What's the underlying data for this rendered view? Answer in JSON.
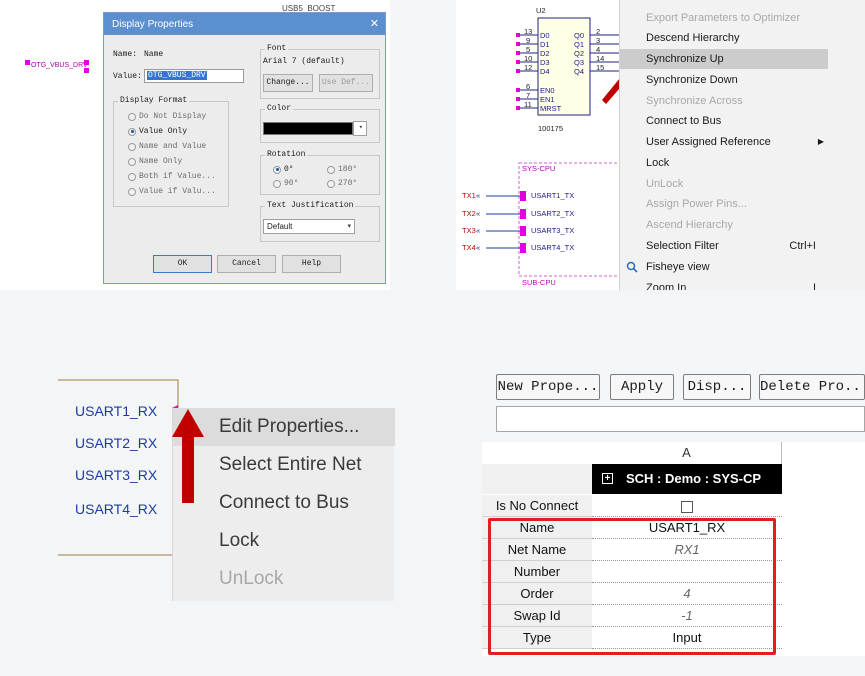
{
  "colors": {
    "accent_red": "#c00000",
    "highlight_box": "#e02020",
    "net_magenta": "#e000e0",
    "net_blue": "#1e3ca0",
    "dialog_title_bg": "#5b8fd0",
    "component_header_bg": "#000000"
  },
  "panel_display_properties": {
    "pin_label": "OTG_VBUS_DRV",
    "top_partial_text": "USB5_BOOST",
    "dialog": {
      "title": "Display Properties",
      "close_icon": "close-icon",
      "name_label": "Name:",
      "name_value": "Name",
      "value_label": "Value:",
      "value_field": "OTG_VBUS_DRV",
      "display_format": {
        "title": "Display Format",
        "options": [
          "Do Not Display",
          "Value Only",
          "Name and Value",
          "Name Only",
          "Both if Value...",
          "Value if Valu..."
        ],
        "selected_index": 1
      },
      "font": {
        "title": "Font",
        "value": "Arial 7 (default)",
        "change_button": "Change...",
        "use_default_button": "Use Def..."
      },
      "color": {
        "title": "Color",
        "swatch": "#000000"
      },
      "rotation": {
        "title": "Rotation",
        "options": [
          "0°",
          "180°",
          "90°",
          "270°"
        ],
        "selected_index": 0
      },
      "justification": {
        "title": "Text Justification",
        "value": "Default"
      },
      "ok_button": "OK",
      "cancel_button": "Cancel",
      "help_button": "Help"
    }
  },
  "panel_context_menu": {
    "schematic": {
      "ref": "U2",
      "part_number": "100175",
      "left_pins": [
        "D0",
        "D1",
        "D2",
        "D3",
        "D4",
        "EN0",
        "EN1",
        "MRST"
      ],
      "left_pin_numbers": [
        "13",
        "9",
        "5",
        "10",
        "12",
        "6",
        "7",
        "11"
      ],
      "right_pins": [
        "Q0",
        "Q1",
        "Q2",
        "Q3",
        "Q4"
      ],
      "right_pin_numbers": [
        "2",
        "3",
        "4",
        "14",
        "15"
      ],
      "sys_block_label": "SYS-CPU",
      "sub_block_label": "SUB-CPU",
      "ports": [
        "USART1_TX",
        "USART2_TX",
        "USART3_TX",
        "USART4_TX"
      ],
      "nets": [
        "TX1",
        "TX2",
        "TX3",
        "TX4"
      ]
    },
    "menu_items": [
      {
        "label": "Export Parameters to Optimizer",
        "disabled": true
      },
      {
        "label": "Descend Hierarchy",
        "disabled": false
      },
      {
        "label": "Synchronize Up",
        "disabled": false,
        "highlighted": true
      },
      {
        "label": "Synchronize Down",
        "disabled": false
      },
      {
        "label": "Synchronize Across",
        "disabled": true
      },
      {
        "label": "Connect to Bus",
        "disabled": false
      },
      {
        "label": "User Assigned Reference",
        "disabled": false,
        "submenu": true
      },
      {
        "label": "Lock",
        "disabled": false
      },
      {
        "label": "UnLock",
        "disabled": true
      },
      {
        "label": "Assign Power Pins...",
        "disabled": true
      },
      {
        "label": "Ascend Hierarchy",
        "disabled": true
      },
      {
        "label": "Selection Filter",
        "disabled": false,
        "shortcut": "Ctrl+I"
      },
      {
        "label": "Fisheye view",
        "disabled": false,
        "icon": "magnifier-icon"
      },
      {
        "label": "Zoom In",
        "disabled": false,
        "shortcut": "I"
      }
    ]
  },
  "panel_edit_properties": {
    "nets": [
      "USART1_RX",
      "USART2_RX",
      "USART3_RX",
      "USART4_RX"
    ],
    "menu_items": [
      {
        "label": "Edit Properties...",
        "disabled": false,
        "highlighted": true
      },
      {
        "label": "Select Entire Net",
        "disabled": false
      },
      {
        "label": "Connect to Bus",
        "disabled": false
      },
      {
        "label": "Lock",
        "disabled": false
      },
      {
        "label": "UnLock",
        "disabled": true
      }
    ]
  },
  "panel_property_editor": {
    "toolbar": {
      "new_property": "New Prope...",
      "apply": "Apply",
      "display": "Disp...",
      "delete_property": "Delete Pro..."
    },
    "column_header": "A",
    "component_header": "SCH : Demo : SYS-CP",
    "expand_icon": "plus-icon",
    "rows": [
      {
        "label": "Is No Connect",
        "value": "",
        "type": "checkbox"
      },
      {
        "label": "Name",
        "value": "USART1_RX",
        "type": "text"
      },
      {
        "label": "Net Name",
        "value": "RX1",
        "type": "readonly"
      },
      {
        "label": "Number",
        "value": "",
        "type": "text"
      },
      {
        "label": "Order",
        "value": "4",
        "type": "readonly"
      },
      {
        "label": "Swap Id",
        "value": "-1",
        "type": "readonly"
      },
      {
        "label": "Type",
        "value": "Input",
        "type": "text"
      }
    ]
  }
}
